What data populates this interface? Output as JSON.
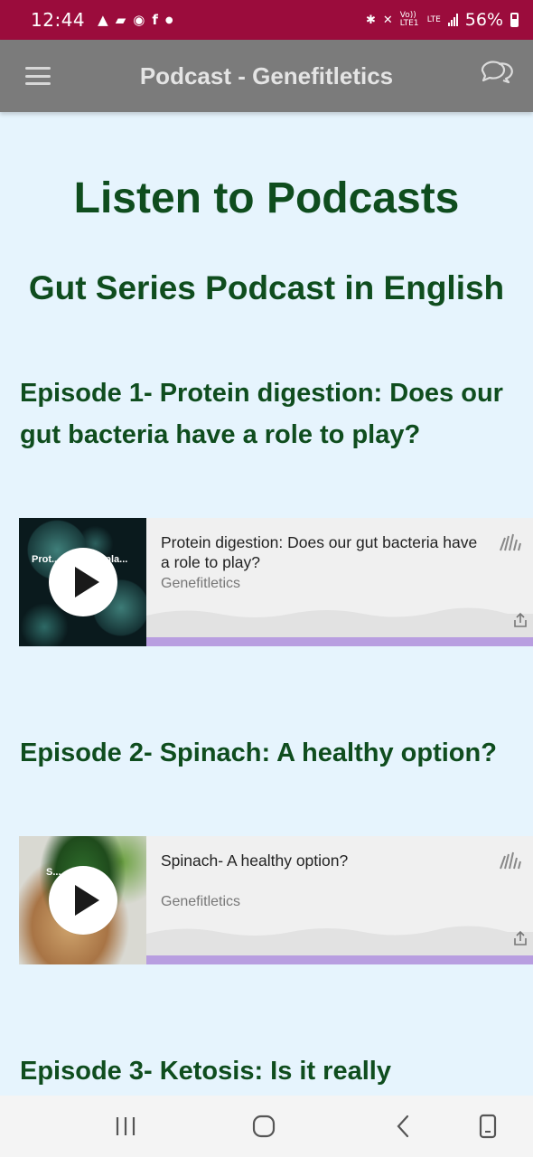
{
  "status_bar": {
    "time": "12:44",
    "notification_icons": [
      "warning-icon",
      "message-icon",
      "phone-icon",
      "facebook-icon",
      "dot-icon"
    ],
    "system_icons": [
      "bluetooth-icon",
      "mute-icon",
      "volte-icon",
      "lte-icon",
      "signal-icon"
    ],
    "volte_label": "Vo)) LTE1",
    "lte_label": "LTE",
    "battery_percent": "56%",
    "background_color": "#9b0c3c"
  },
  "app_bar": {
    "title": "Podcast - Genefitletics",
    "background_color": "#7b7b7b"
  },
  "page": {
    "heading": "Listen to Podcasts",
    "subheading": "Gut Series Podcast in English",
    "heading_color": "#0f4d1e",
    "background_color": "#e6f4fd"
  },
  "episodes": [
    {
      "title": "Episode 1- Protein digestion: Does our gut bacteria have a role to play?",
      "player": {
        "track_title": "Protein digestion: Does our gut bacteria have a role to play?",
        "author": "Genefitletics",
        "thumbnail_text": "Prot...on- Do ... pla..."
      }
    },
    {
      "title": "Episode 2- Spinach: A healthy option?",
      "player": {
        "track_title": "Spinach- A healthy option?",
        "author": "Genefitletics",
        "thumbnail_text": "S..."
      }
    },
    {
      "title": "Episode 3- Ketosis: Is it really"
    }
  ],
  "player_accent_color": "#b89ee0",
  "nav_bar": {
    "buttons": [
      "recent-apps-icon",
      "home-icon",
      "back-icon",
      "rotate-icon"
    ]
  }
}
